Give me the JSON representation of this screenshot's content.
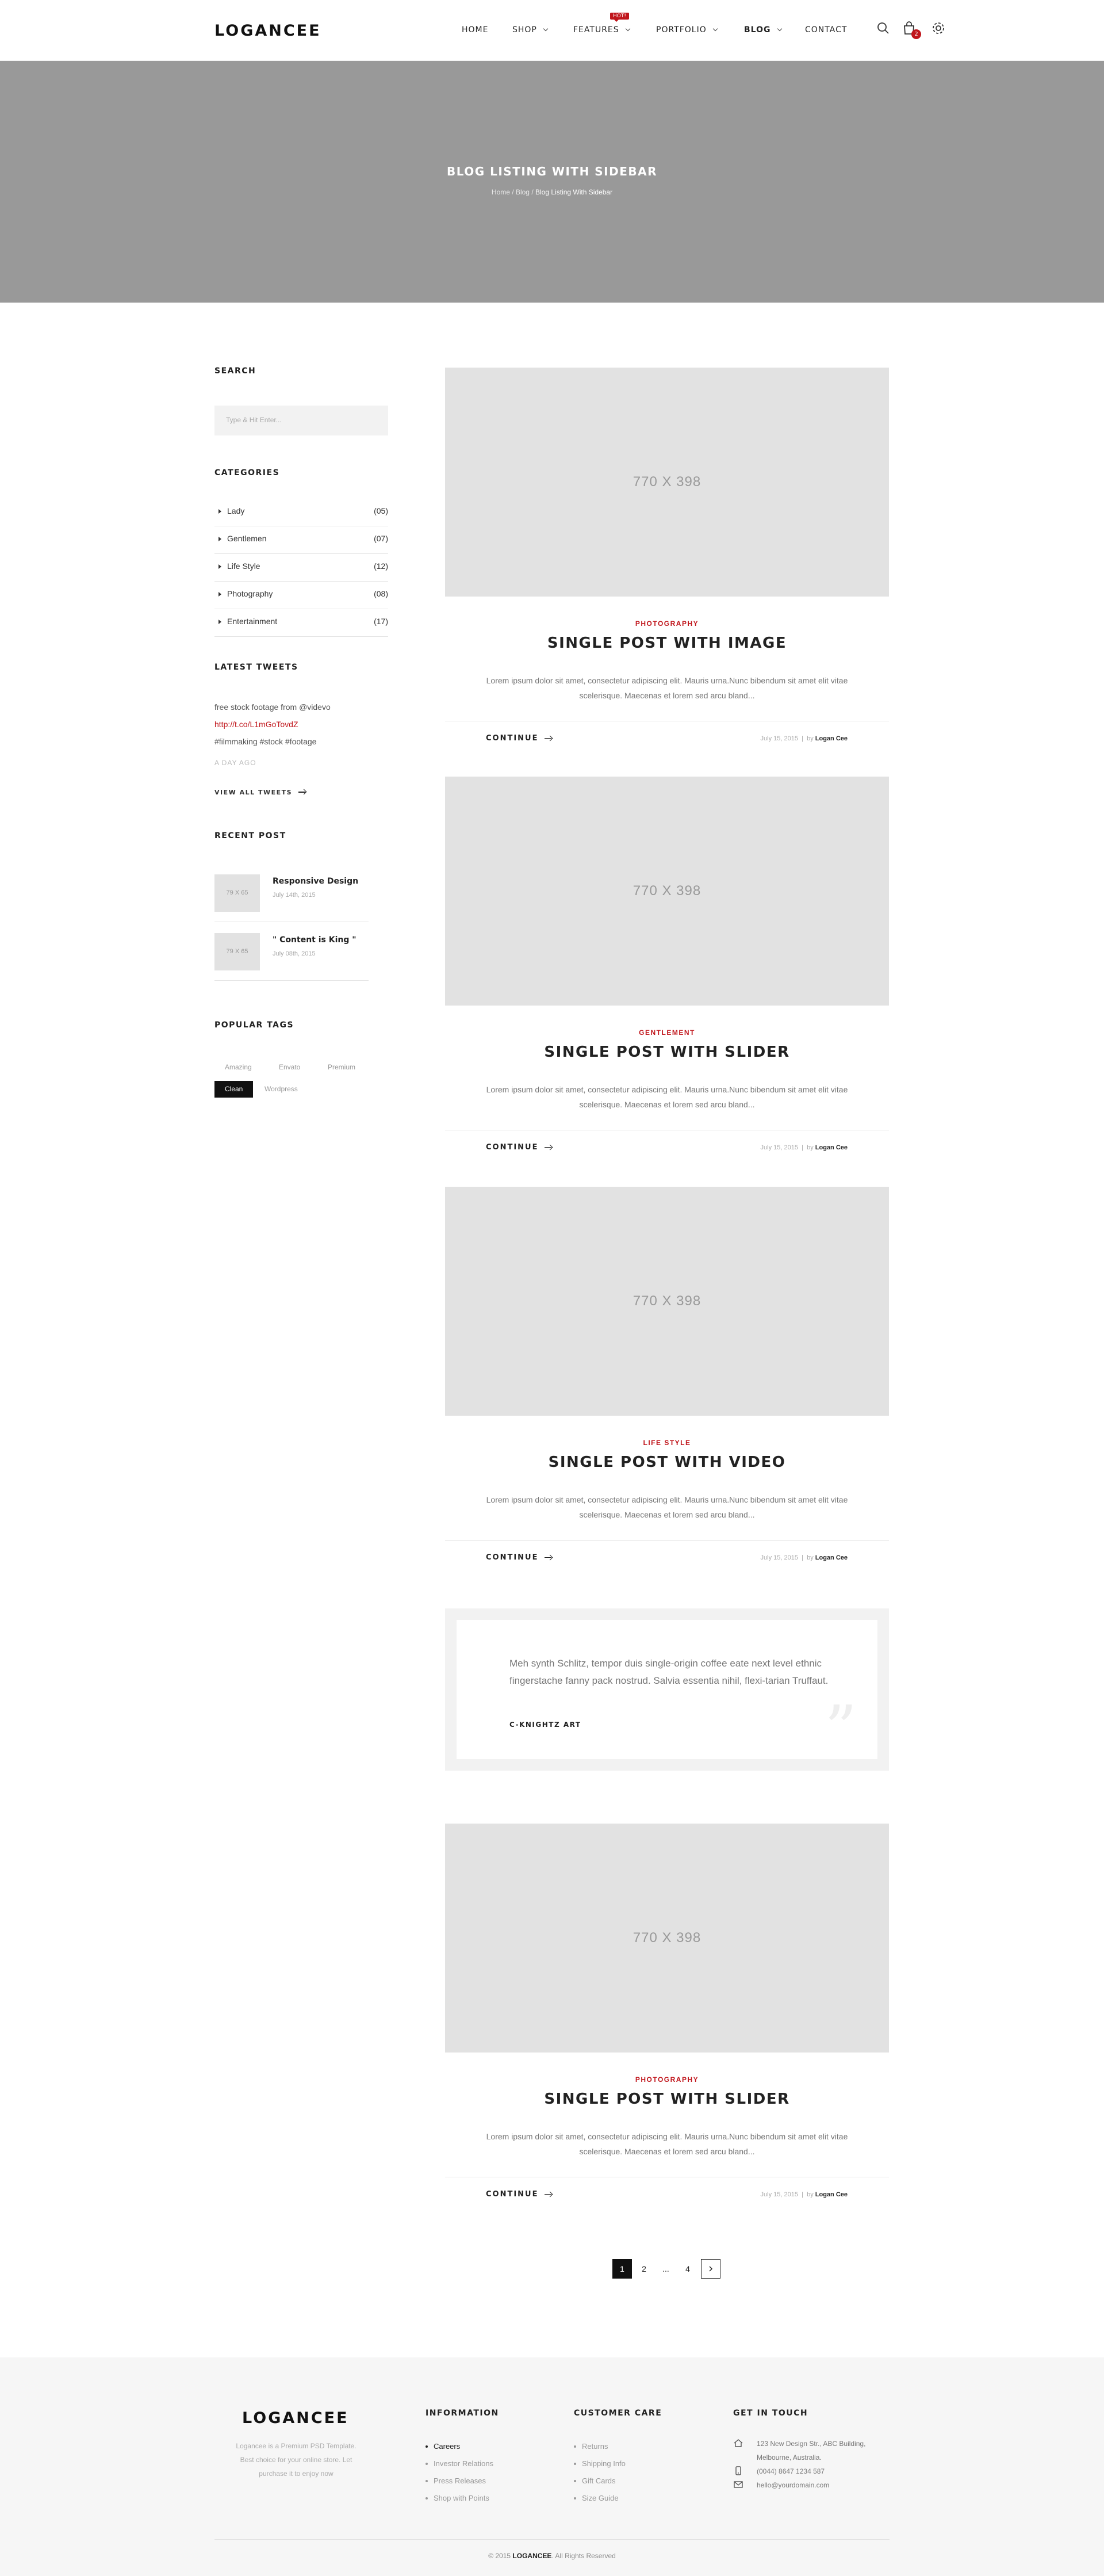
{
  "header": {
    "logo": "LOGANCEE",
    "nav": {
      "home": "HOME",
      "shop": "SHOP",
      "features": "FEATURES",
      "features_badge": "HOT!",
      "portfolio": "PORTFOLIO",
      "blog": "BLOG",
      "contact": "CONTACT"
    },
    "cart_count": "2",
    "icons": [
      "search-icon",
      "cart-icon",
      "settings-icon"
    ]
  },
  "banner": {
    "title": "BLOG LISTING WITH SIDEBAR",
    "crumb_home": "Home",
    "crumb_sep1": " / ",
    "crumb_blog": "Blog",
    "crumb_sep2": " / ",
    "crumb_current": "Blog Listing With Sidebar"
  },
  "sidebar": {
    "search_title": "SEARCH",
    "search_placeholder": "Type & Hit Enter...",
    "categories_title": "CATEGORIES",
    "categories": [
      {
        "label": "Lady",
        "count": "(05)"
      },
      {
        "label": "Gentlemen",
        "count": "(07)"
      },
      {
        "label": "Life Style",
        "count": "(12)"
      },
      {
        "label": "Photography",
        "count": "(08)"
      },
      {
        "label": "Entertainment",
        "count": "(17)"
      }
    ],
    "tweets_title": "LATEST TWEETS",
    "tweet_line1": "free stock footage from @videvo",
    "tweet_link": "http://t.co/L1mGoTovdZ",
    "tweet_line3": "#filmmaking #stock #footage",
    "tweet_time": "A DAY AGO",
    "view_all": "VIEW ALL TWEETS",
    "recent_title": "RECENT POST",
    "recent_posts": [
      {
        "thumb": "79 X 65",
        "title": "Responsive Design",
        "date": "July 14th, 2015"
      },
      {
        "thumb": "79 X 65",
        "title": "\" Content is King \"",
        "date": "July 08th, 2015"
      }
    ],
    "tags_title": "POPULAR TAGS",
    "tags": [
      "Amazing",
      "Envato",
      "Premium",
      "Clean",
      "Wordpress"
    ]
  },
  "posts": [
    {
      "image": "770 X 398",
      "category": "PHOTOGRAPHY",
      "title": "SINGLE POST WITH IMAGE",
      "excerpt": "Lorem ipsum dolor sit amet, consectetur adipiscing elit. Mauris urna.Nunc bibendum sit amet elit vitae scelerisque. Maecenas et lorem sed arcu bland...",
      "continue": "CONTINUE",
      "date": "July 15, 2015",
      "sep": "|",
      "by": "by",
      "author": "Logan Cee"
    },
    {
      "image": "770 X 398",
      "category": "GENTLEMENT",
      "title": "SINGLE POST WITH SLIDER",
      "excerpt": "Lorem ipsum dolor sit amet, consectetur adipiscing elit. Mauris urna.Nunc bibendum sit amet elit vitae scelerisque. Maecenas et lorem sed arcu bland...",
      "continue": "CONTINUE",
      "date": "July 15, 2015",
      "sep": "|",
      "by": "by",
      "author": "Logan Cee"
    },
    {
      "image": "770 X 398",
      "category": "LIFE STYLE",
      "title": "SINGLE POST WITH VIDEO",
      "excerpt": "Lorem ipsum dolor sit amet, consectetur adipiscing elit. Mauris urna.Nunc bibendum sit amet elit vitae scelerisque. Maecenas et lorem sed arcu bland...",
      "continue": "CONTINUE",
      "date": "July 15, 2015",
      "sep": "|",
      "by": "by",
      "author": "Logan Cee"
    },
    {
      "image": "770 X 398",
      "category": "PHOTOGRAPHY",
      "title": "SINGLE POST WITH SLIDER",
      "excerpt": "Lorem ipsum dolor sit amet, consectetur adipiscing elit. Mauris urna.Nunc bibendum sit amet elit vitae scelerisque. Maecenas et lorem sed arcu bland...",
      "continue": "CONTINUE",
      "date": "July 15, 2015",
      "sep": "|",
      "by": "by",
      "author": "Logan Cee"
    }
  ],
  "quote": {
    "text": "Meh synth Schlitz, tempor duis single-origin coffee eate next level ethnic fingerstache fanny pack nostrud. Salvia essentia nihil, flexi-tarian Truffaut.",
    "author": "C-KNIGHTZ ART",
    "mark": "”"
  },
  "pagination": [
    "1",
    "2",
    "...",
    "4"
  ],
  "footer": {
    "logo": "LOGANCEE",
    "description": "Logancee is a Premium PSD Template. Best choice for your online store. Let purchase it to enjoy now",
    "information_title": "INFORMATION",
    "information_links": [
      "Careers",
      "Investor Relations",
      "Press Releases",
      "Shop with Points"
    ],
    "care_title": "CUSTOMER CARE",
    "care_links": [
      "Returns",
      "Shipping Info",
      "Gift Cards",
      "Size Guide"
    ],
    "touch_title": "GET IN TOUCH",
    "address_line1": "123 New Design Str., ABC Building,",
    "address_line2": "Melbourne, Australia.",
    "phone": "(0044) 8647 1234 587",
    "email": "hello@yourdomain.com",
    "copy_prefix": "© 2015 ",
    "copy_brand": "LOGANCEE",
    "copy_suffix": ". All Rights Reserved"
  },
  "colors": {
    "accent": "#c0151b",
    "banner": "#999999",
    "placeholder": "#e2e2e2",
    "dark": "#111111"
  }
}
